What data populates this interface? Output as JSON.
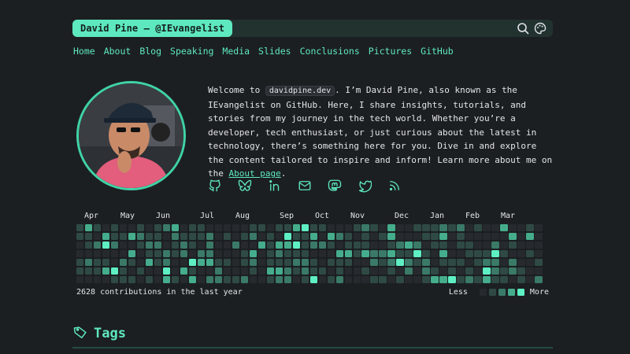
{
  "header": {
    "brand": "David Pine — @IEvangelist",
    "icons": [
      "search-icon",
      "palette-icon"
    ]
  },
  "nav": [
    "Home",
    "About",
    "Blog",
    "Speaking",
    "Media",
    "Slides",
    "Conclusions",
    "Pictures",
    "GitHub"
  ],
  "intro": {
    "p1": "Welcome to ",
    "code": "davidpine.dev",
    "p2": ". I’m David Pine, also known as the IEvangelist on GitHub. Here, I share insights, tutorials, and stories from my journey in the tech world. Whether you’re a developer, tech enthusiast, or just curious about the latest in technology, there’s something here for you. Dive in and explore the content tailored to inspire and inform! Learn more about me on the ",
    "link": "About page",
    "p3": "."
  },
  "social_icons": [
    "github-icon",
    "bluesky-icon",
    "linkedin-icon",
    "email-icon",
    "mastodon-icon",
    "twitter-icon",
    "rss-icon"
  ],
  "calendar": {
    "months": [
      "Apr",
      "May",
      "Jun",
      "Jul",
      "Aug",
      "Sep",
      "Oct",
      "Nov",
      "Dec",
      "Jan",
      "Feb",
      "Mar"
    ],
    "summary": "2628 contributions in the last year",
    "legend_less": "Less",
    "legend_more": "More",
    "colors": [
      "#262a2e",
      "#2f4a44",
      "#3a7a67",
      "#45ad8b",
      "#5eefc3"
    ]
  },
  "tags": {
    "title": "Tags"
  },
  "colors": {
    "accent": "#5ee8c0",
    "background": "#1c1f22"
  }
}
